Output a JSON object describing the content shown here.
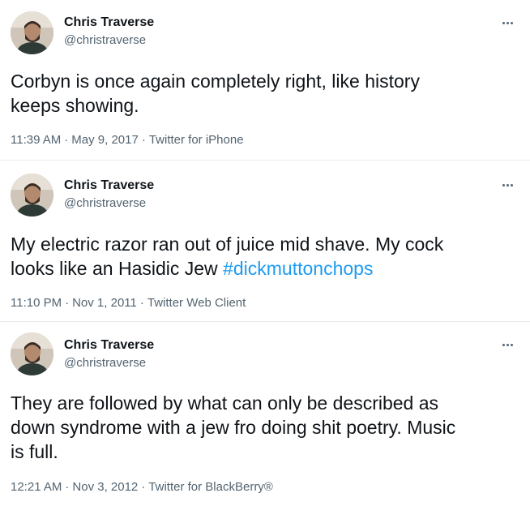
{
  "tweets": [
    {
      "name": "Chris Traverse",
      "handle": "@christraverse",
      "text_lines": [
        "Corbyn is once again completely right, like history",
        "keeps showing."
      ],
      "time": "11:39 AM",
      "separator": "·",
      "date": "May 9, 2017",
      "source": "Twitter for iPhone",
      "more_icon": "more-dots-icon"
    },
    {
      "name": "Chris Traverse",
      "handle": "@christraverse",
      "text_lines": [
        "My electric razor ran out of juice mid shave. My cock",
        "looks like an Hasidic Jew "
      ],
      "hashtag": "#dickmuttonchops",
      "time": "11:10 PM",
      "separator": "·",
      "date": "Nov 1, 2011",
      "source": "Twitter Web Client",
      "more_icon": "more-dots-icon"
    },
    {
      "name": "Chris Traverse",
      "handle": "@christraverse",
      "text_lines": [
        "They are followed by what can only be described as",
        "down syndrome with a jew fro doing shit poetry.  Music",
        "is full."
      ],
      "time": "12:21 AM",
      "separator": "·",
      "date": "Nov 3, 2012",
      "source": "Twitter for BlackBerry®",
      "more_icon": "more-dots-icon"
    }
  ],
  "colors": {
    "text": "#0f1419",
    "secondary": "#536471",
    "link": "#1d9bf0",
    "divider": "#e8ecef"
  }
}
